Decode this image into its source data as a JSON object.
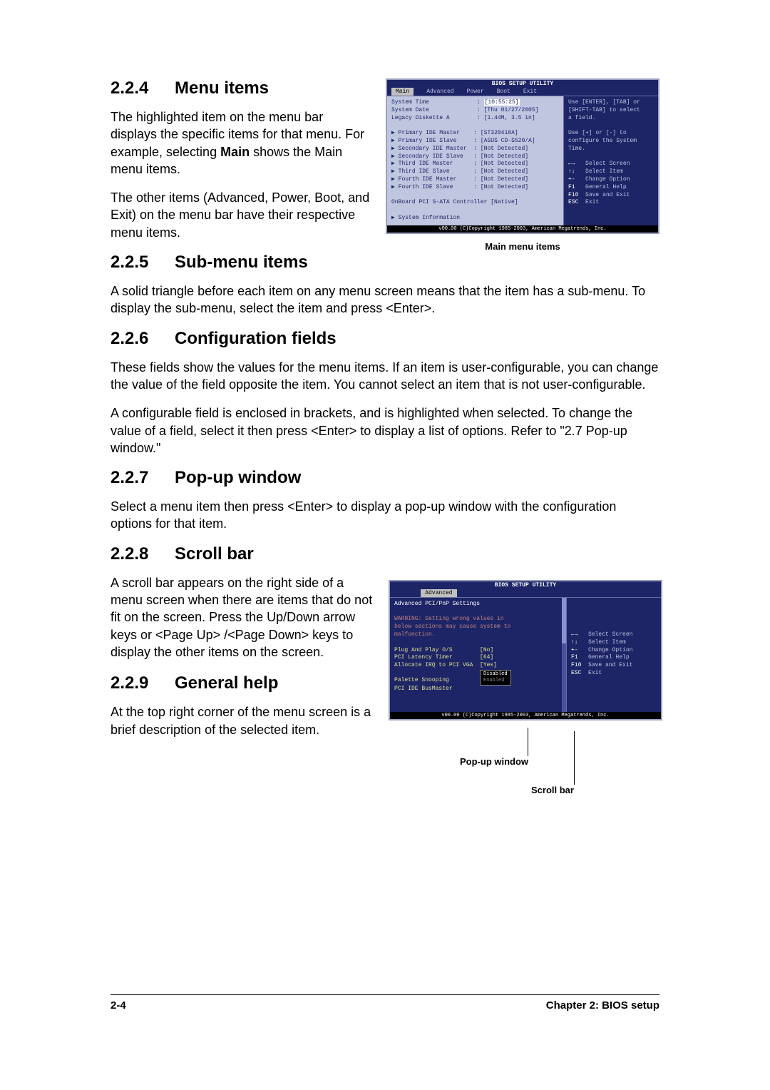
{
  "sections": {
    "s224": {
      "num": "2.2.4",
      "title": "Menu items",
      "p1": "The highlighted item on the menu bar displays the specific items for that menu. For example, selecting ",
      "p1b": "Main",
      "p1c": " shows the Main menu items.",
      "p2": "The other items (Advanced, Power, Boot, and Exit) on the menu bar have their respective menu items."
    },
    "s225": {
      "num": "2.2.5",
      "title": "Sub-menu items",
      "p1": "A solid triangle before each item on any menu screen means that the item has a sub-menu. To display the sub-menu, select the item and press <Enter>."
    },
    "s226": {
      "num": "2.2.6",
      "title": "Configuration fields",
      "p1": "These fields show the values for the menu items. If an item is user-configurable, you can change the value of the field opposite the item. You cannot select an item that is not user-configurable.",
      "p2": "A configurable field is enclosed in brackets, and is highlighted when selected. To change the value of a field, select it then press <Enter> to display a list of options. Refer to  \"2.7 Pop-up window.\""
    },
    "s227": {
      "num": "2.2.7",
      "title": "Pop-up window",
      "p1": "Select a menu item then press <Enter> to display a pop-up window with the configuration options for that item."
    },
    "s228": {
      "num": "2.2.8",
      "title": "Scroll bar",
      "p1": "A scroll bar appears on the right side of a menu screen when there are items that do not fit on the screen. Press the Up/Down arrow keys or <Page Up> /<Page Down> keys to display the other items on the screen."
    },
    "s229": {
      "num": "2.2.9",
      "title": "General help",
      "p1": "At the top right corner of the menu screen is a brief description of the selected item."
    }
  },
  "bios1": {
    "title": "BIOS SETUP UTILITY",
    "menubar": [
      "Main",
      "Advanced",
      "Power",
      "Boot",
      "Exit"
    ],
    "active_tab": "Main",
    "left_rows": [
      [
        "System Time",
        "[10:55:25]"
      ],
      [
        "System Date",
        "[Thu 01/27/2005]"
      ],
      [
        "Legacy Diskette A",
        "[1.44M, 3.5 in]"
      ]
    ],
    "sub_rows": [
      [
        "Primary IDE Master",
        "[ST320410A]"
      ],
      [
        "Primary IDE Slave",
        "[ASUS CD-S520/A]"
      ],
      [
        "Secondary IDE Master",
        "[Not Detected]"
      ],
      [
        "Secondary IDE Slave",
        "[Not Detected]"
      ],
      [
        "Third IDE Master",
        "[Not Detected]"
      ],
      [
        "Third IDE Slave",
        "[Not Detected]"
      ],
      [
        "Fourth IDE Master",
        "[Not Detected]"
      ],
      [
        "Fourth IDE Slave",
        "[Not Detected]"
      ]
    ],
    "extra": "OnBoard PCI S-ATA Controller [Native]",
    "sysinfo": "System Information",
    "help_top": [
      "Use [ENTER], [TAB] or",
      "[SHIFT-TAB] to select",
      "a field.",
      "",
      "Use [+] or [-] to",
      "configure the System",
      "Time."
    ],
    "help_keys": [
      [
        "←→",
        "Select Screen"
      ],
      [
        "↑↓",
        "Select Item"
      ],
      [
        "+-",
        "Change Option"
      ],
      [
        "F1",
        "General Help"
      ],
      [
        "F10",
        "Save and Exit"
      ],
      [
        "ESC",
        "Exit"
      ]
    ],
    "footer": "v00.00 (C)Copyright 1985-2003, American Megatrends, Inc.",
    "caption": "Main menu items"
  },
  "bios2": {
    "title": "BIOS SETUP UTILITY",
    "active_tab": "Advanced",
    "heading": "Advanced PCI/PnP Settings",
    "warning": [
      "WARNING: Setting wrong values in",
      "below sections may cause system to",
      "malfunction."
    ],
    "rows": [
      [
        "Plug And Play O/S",
        "[No]"
      ],
      [
        "PCI Latency Timer",
        "[64]"
      ],
      [
        "Allocate IRQ to PCI VGA",
        "[Yes]"
      ],
      [
        "Palette Snooping",
        ""
      ],
      [
        "PCI IDE BusMaster",
        ""
      ]
    ],
    "popup": {
      "opt1": "Disabled",
      "opt2": "Enabled"
    },
    "help_keys": [
      [
        "←→",
        "Select Screen"
      ],
      [
        "↑↓",
        "Select Item"
      ],
      [
        "+-",
        "Change Option"
      ],
      [
        "F1",
        "General Help"
      ],
      [
        "F10",
        "Save and Exit"
      ],
      [
        "ESC",
        "Exit"
      ]
    ],
    "footer": "v00.00 (C)Copyright 1985-2003, American Megatrends, Inc.",
    "label_popup": "Pop-up window",
    "label_scroll": "Scroll bar"
  },
  "footer": {
    "left": "2-4",
    "right": "Chapter 2: BIOS setup"
  }
}
